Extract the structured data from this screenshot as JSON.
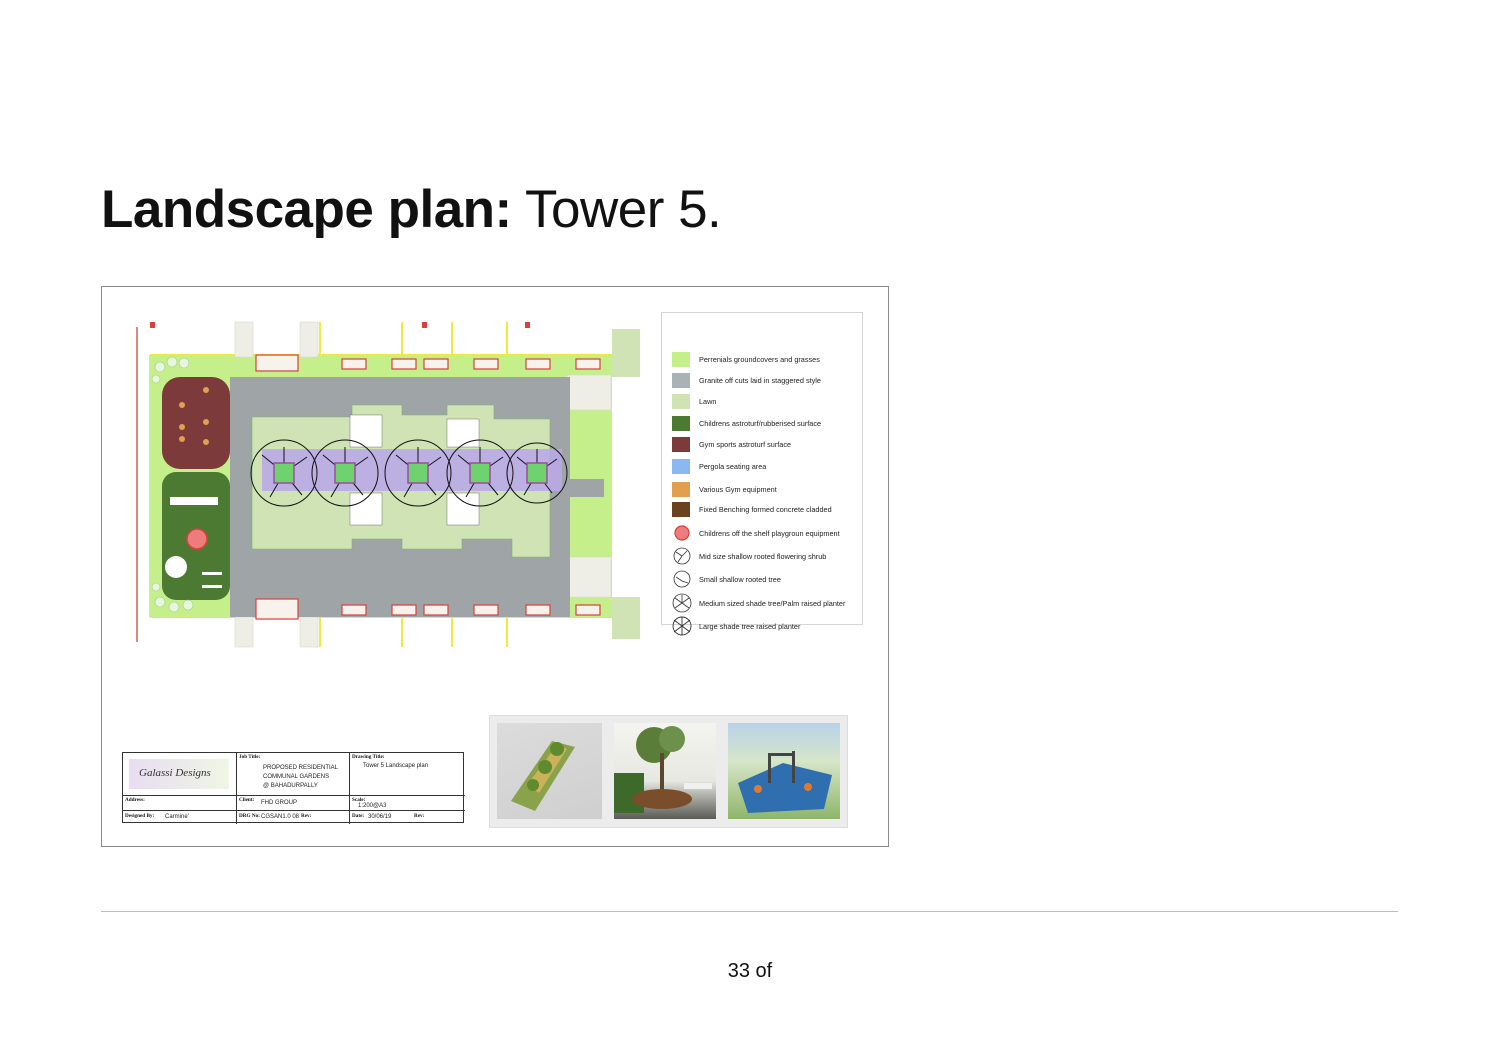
{
  "page": {
    "title_bold": "Landscape plan:",
    "title_light": "Tower 5.",
    "page_number": "33 of"
  },
  "legend": [
    {
      "label": "Perrenials groundcovers and grasses",
      "kind": "swatch",
      "color": "#c5ef8a"
    },
    {
      "label": "Granite off cuts laid in staggered style",
      "kind": "swatch",
      "color": "#a9b3b5"
    },
    {
      "label": "Lawn",
      "kind": "swatch",
      "color": "#cfe3b4"
    },
    {
      "label": "Childrens  astroturf/rubberised surface",
      "kind": "swatch",
      "color": "#4d7a32"
    },
    {
      "label": "Gym  sports astroturf surface",
      "kind": "swatch",
      "color": "#7d3a3a"
    },
    {
      "label": "Pergola seating area",
      "kind": "swatch",
      "color": "#8ab8f0"
    },
    {
      "label": "Various Gym equipment",
      "kind": "swatch",
      "color": "#e0a050"
    },
    {
      "label": "Fixed Benching formed concrete cladded",
      "kind": "swatch",
      "color": "#6b4220"
    },
    {
      "label": "Childrens off the shelf playgroun equipment",
      "kind": "symbol",
      "icon": "play-equipment-icon"
    },
    {
      "label": "Mid size shallow rooted flowering shrub",
      "kind": "symbol",
      "icon": "shrub-icon"
    },
    {
      "label": "Small shallow rooted tree",
      "kind": "symbol",
      "icon": "small-tree-icon"
    },
    {
      "label": "Medium sized shade tree/Palm raised planter",
      "kind": "symbol",
      "icon": "medium-tree-icon"
    },
    {
      "label": "Large shade tree raised planter",
      "kind": "symbol",
      "icon": "large-tree-icon"
    }
  ],
  "titleblock": {
    "logo_text": "Galassi Designs",
    "job_title_caption": "Job Title:",
    "job_title": [
      "PROPOSED RESIDENTIAL",
      "COMMUNAL GARDENS",
      "@ BAHADURPALLY"
    ],
    "drawing_title_caption": "Drawing Title:",
    "drawing_title": "Tower 5 Landscape plan",
    "address_caption": "Address:",
    "client_caption": "Client:",
    "client": "FHD GROUP",
    "scale_caption": "Scale:",
    "scale": "1:200@A3",
    "designed_by_caption": "Designed By:",
    "designed_by": "Carmine'",
    "drg_no_caption": "DRG No:",
    "drg_no": "CGSAN1.0 08",
    "rev_caption": "Rev:",
    "date_caption": "Date:",
    "date": "30/06/19",
    "rev2_caption": "Rev:"
  },
  "colors": {
    "paving": "#9fa5a7",
    "lawn": "#cfe3b4",
    "groundcover": "#c5ef8a",
    "gym_surface": "#7d3a3a",
    "kids_surface": "#4d7a32",
    "pergola": "#b9a8e6",
    "boundary_yellow": "#f2ea3a",
    "planter_red": "#d9403a"
  }
}
